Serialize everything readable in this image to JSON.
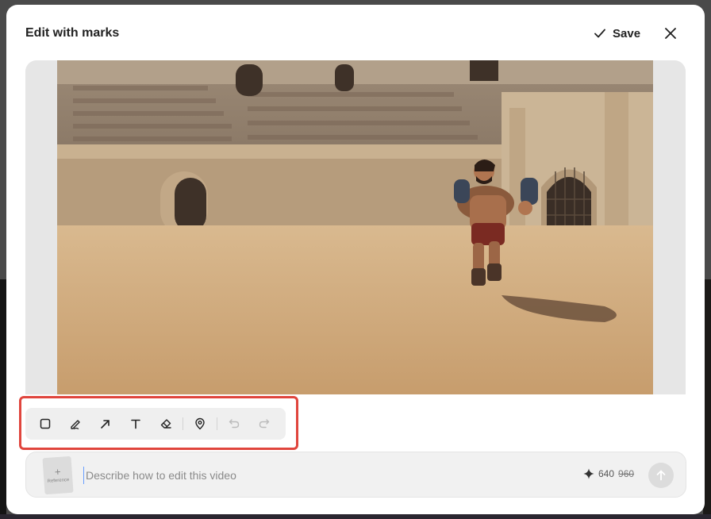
{
  "modal": {
    "title": "Edit with marks",
    "save_label": "Save"
  },
  "toolbar": {
    "tools": [
      "rectangle-icon",
      "pen-icon",
      "arrow-icon",
      "text-icon",
      "eraser-icon",
      "location-pin-icon",
      "undo-icon",
      "redo-icon"
    ]
  },
  "prompt": {
    "placeholder": "Describe how to edit this video",
    "reference_plus": "+",
    "reference_label": "Reference",
    "credits_new": "640",
    "credits_old": "960"
  },
  "colors": {
    "highlight": "#e0453d",
    "caret": "#6aa0ff"
  }
}
